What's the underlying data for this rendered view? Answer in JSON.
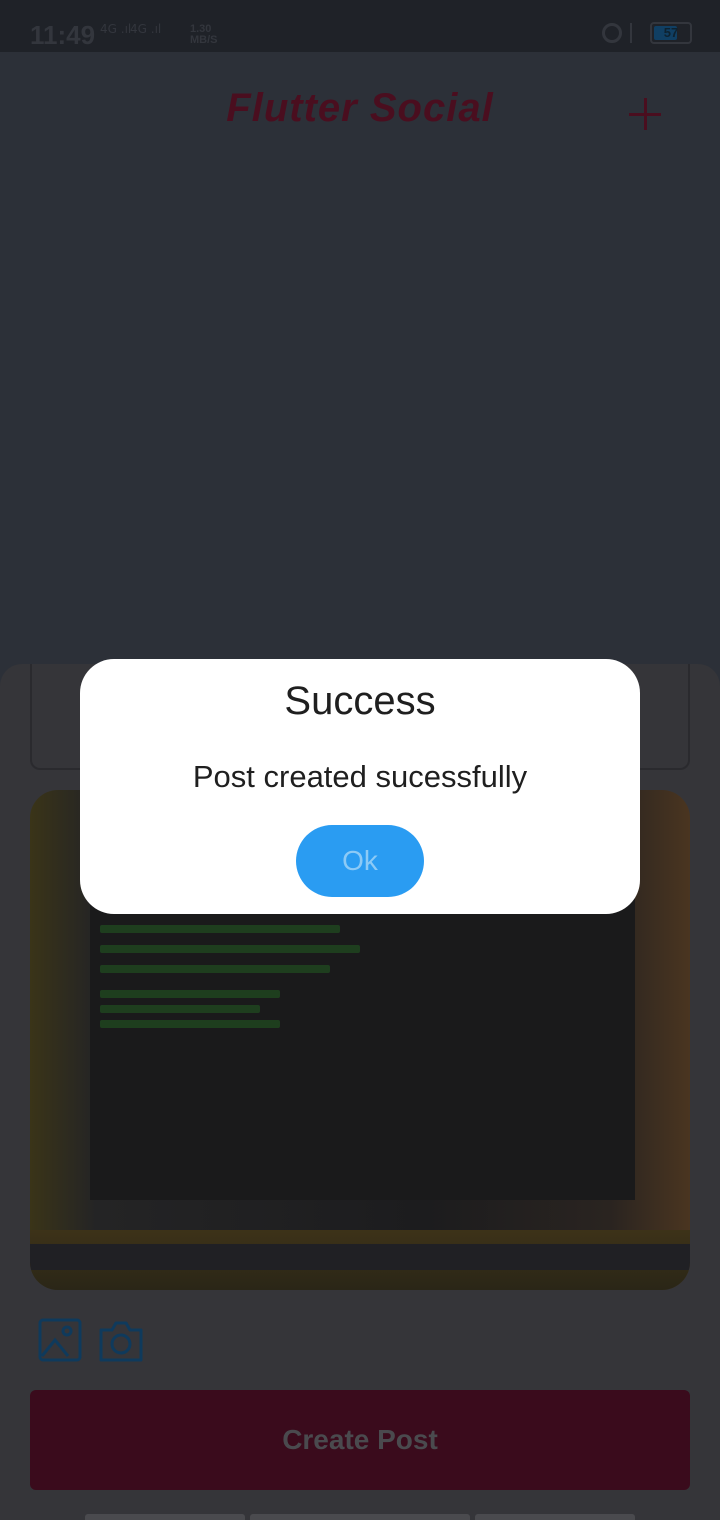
{
  "status_bar": {
    "time": "11:49",
    "signal_1": "4G .ıl",
    "signal_2": "4G .ıl",
    "speed_value": "1.30",
    "speed_unit": "MB/S",
    "battery_level": "57"
  },
  "app_bar": {
    "title": "Flutter Social",
    "add_icon": "plus-icon"
  },
  "composer": {
    "image_icon": "image-icon",
    "camera_icon": "camera-icon",
    "create_label": "Create Post"
  },
  "dialog": {
    "title": "Success",
    "message": "Post created sucessfully",
    "ok_label": "Ok"
  },
  "colors": {
    "accent": "#2a9cf2",
    "brand": "#4a0e1f",
    "button": "#3a0b1c"
  }
}
